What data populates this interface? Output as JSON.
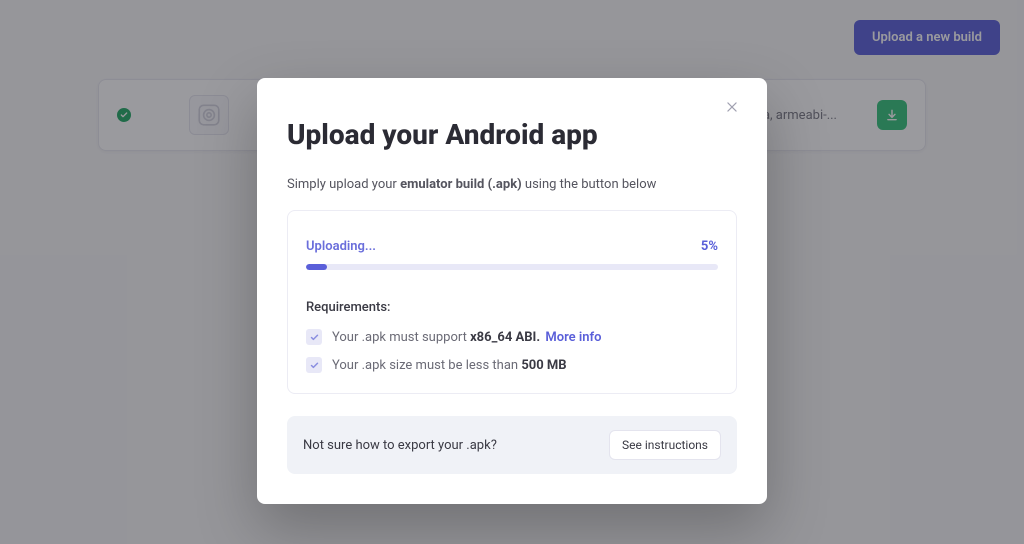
{
  "header": {
    "upload_button": "Upload a new build"
  },
  "build_row": {
    "arch": "a, armeabi-..."
  },
  "modal": {
    "title": "Upload your Android app",
    "subtitle_pre": "Simply upload your ",
    "subtitle_bold": "emulator build (.apk)",
    "subtitle_post": " using the button below",
    "progress": {
      "label": "Uploading...",
      "percent_text": "5%",
      "percent_value": 5
    },
    "requirements": {
      "title": "Requirements:",
      "items": [
        {
          "pre": "Your .apk must support ",
          "strong": "x86_64 ABI.",
          "link": "More info"
        },
        {
          "pre": "Your .apk size must be less than ",
          "strong": "500 MB",
          "link": ""
        }
      ]
    },
    "help": {
      "text": "Not sure how to export your .apk?",
      "button": "See instructions"
    }
  }
}
